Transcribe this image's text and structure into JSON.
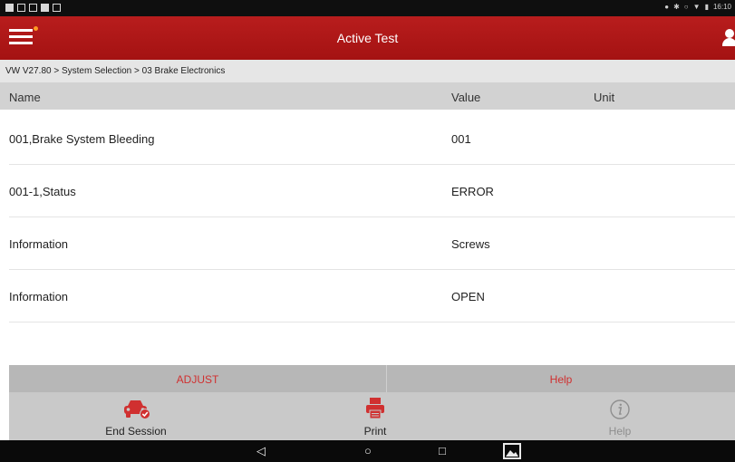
{
  "status_bar": {
    "time": "16:10"
  },
  "header": {
    "title": "Active Test"
  },
  "breadcrumb": "VW V27.80 > System Selection > 03 Brake Electronics",
  "table": {
    "headers": {
      "name": "Name",
      "value": "Value",
      "unit": "Unit"
    },
    "rows": [
      {
        "name": "001,Brake System Bleeding",
        "value": "001",
        "unit": ""
      },
      {
        "name": "001-1,Status",
        "value": "ERROR",
        "unit": ""
      },
      {
        "name": "Information",
        "value": "Screws",
        "unit": ""
      },
      {
        "name": "Information",
        "value": "OPEN",
        "unit": ""
      }
    ]
  },
  "actions": {
    "adjust": "ADJUST",
    "help": "Help"
  },
  "toolbar": {
    "end_session": "End Session",
    "print": "Print",
    "help": "Help"
  },
  "colors": {
    "header_red": "#b01818",
    "accent_red": "#d03030",
    "disabled_gray": "#8e8e8e"
  },
  "icons": {
    "menu": "hamburger-menu-icon",
    "user": "user-icon",
    "end_session": "car-check-icon",
    "print": "printer-icon",
    "help": "info-icon",
    "nav_back": "back-triangle-icon",
    "nav_home": "home-circle-icon",
    "nav_recent": "recent-square-icon",
    "nav_screenshot": "gallery-icon"
  }
}
